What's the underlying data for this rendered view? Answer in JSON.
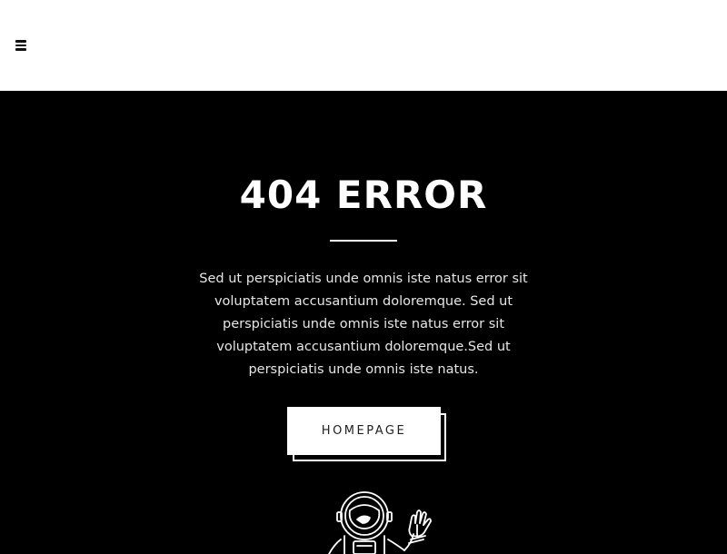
{
  "header": {
    "menu_icon": "hamburger-menu-icon"
  },
  "hero": {
    "title": "404 ERROR",
    "description": "Sed ut perspiciatis unde omnis iste natus error sit voluptatem accusantium doloremque. Sed ut perspiciatis unde omnis iste natus error sit voluptatem accusantium doloremque.Sed ut perspiciatis unde omnis iste natus.",
    "button_label": "HOMEPAGE",
    "illustration_icon": "astronaut-icon"
  },
  "colors": {
    "background": "#000000",
    "header_background": "#ffffff",
    "text": "#ffffff",
    "button_background": "#ffffff",
    "button_text": "#222222"
  }
}
